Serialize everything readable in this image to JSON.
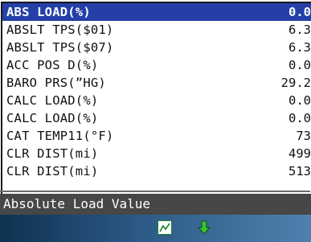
{
  "pids": [
    {
      "name": "ABS LOAD(%)",
      "value": "0.0"
    },
    {
      "name": "ABSLT TPS($01)",
      "value": "6.3"
    },
    {
      "name": "ABSLT TPS($07)",
      "value": "6.3"
    },
    {
      "name": "ACC POS D(%)",
      "value": "0.0"
    },
    {
      "name": "BARO PRS(”HG)",
      "value": "29.2"
    },
    {
      "name": "CALC LOAD(%)",
      "value": "0.0"
    },
    {
      "name": "CALC LOAD(%)",
      "value": "0.0"
    },
    {
      "name": "CAT TEMP11(°F)",
      "value": "73"
    },
    {
      "name": "CLR DIST(mi)",
      "value": "499"
    },
    {
      "name": "CLR DIST(mi)",
      "value": "513"
    }
  ],
  "selected_index": 0,
  "description": "Absolute Load Value",
  "toolbar": {
    "graph_icon": "graph-icon",
    "down_icon": "arrow-down-icon"
  },
  "colors": {
    "selection": "#2440a8",
    "description_bar": "#474747",
    "toolbar_start": "#0e3250",
    "toolbar_end": "#4f80ad",
    "icon_green": "#1b7f2b"
  }
}
